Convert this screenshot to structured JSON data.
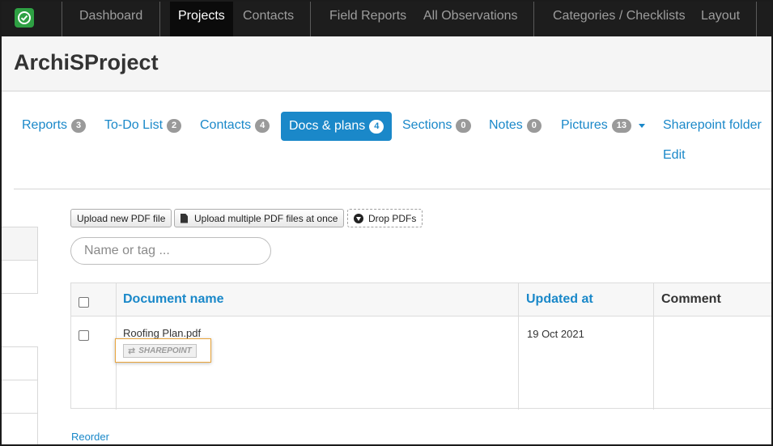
{
  "nav": {
    "logo_icon": "check-circle-icon",
    "items": [
      "Dashboard",
      "Projects",
      "Contacts",
      "Field Reports",
      "All Observations",
      "Categories / Checklists",
      "Layout"
    ],
    "active": "Projects"
  },
  "project": {
    "title": "ArchiSProject"
  },
  "tabs": [
    {
      "label": "Reports",
      "count": "3"
    },
    {
      "label": "To-Do List",
      "count": "2"
    },
    {
      "label": "Contacts",
      "count": "4"
    },
    {
      "label": "Docs & plans",
      "count": "4"
    },
    {
      "label": "Sections",
      "count": "0"
    },
    {
      "label": "Notes",
      "count": "0"
    },
    {
      "label": "Pictures",
      "count": "13"
    },
    {
      "label": "Sharepoint folder"
    },
    {
      "label": "Edit"
    }
  ],
  "active_tab": "Docs & plans",
  "toolbar": {
    "upload_pdf": "Upload new PDF file",
    "upload_multiple": "Upload multiple PDF files at once",
    "drop_pdfs": "Drop PDFs"
  },
  "search": {
    "placeholder": "Name or tag ..."
  },
  "table": {
    "headers": [
      "Document name",
      "Updated at",
      "Comment"
    ],
    "rows": [
      {
        "name": "Roofing Plan.pdf",
        "tag": "SHAREPOINT",
        "updated": "19 Oct 2021",
        "comment": ""
      }
    ]
  },
  "reorder": "Reorder",
  "colors": {
    "accent": "#1a88c9",
    "navbar": "#1d1d1d",
    "logo": "#2ea043",
    "highlight": "#e8a33a"
  }
}
